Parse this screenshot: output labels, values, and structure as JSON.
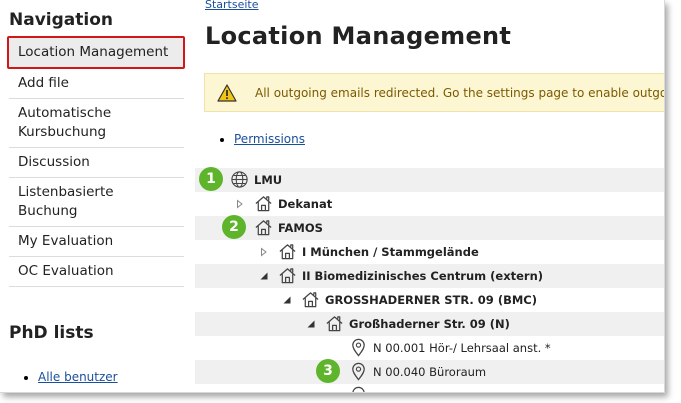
{
  "breadcrumb": "Startseite",
  "sidebar": {
    "heading": "Navigation",
    "items": [
      {
        "label": "Location Management"
      },
      {
        "label": "Add file"
      },
      {
        "label": "Automatische Kursbuchung"
      },
      {
        "label": "Discussion"
      },
      {
        "label": "Listenbasierte Buchung"
      },
      {
        "label": "My Evaluation"
      },
      {
        "label": "OC Evaluation"
      }
    ],
    "phd_heading": "PhD lists",
    "phd_items": [
      {
        "label": "Alle benutzer"
      }
    ]
  },
  "main": {
    "title": "Location Management",
    "alert": "All outgoing emails redirected. Go the settings page to enable outgoing emails.",
    "links": [
      {
        "label": "Permissions"
      }
    ],
    "tree": [
      {
        "label": "LMU",
        "icon": "globe-icon"
      },
      {
        "label": "Dekanat",
        "icon": "house-icon"
      },
      {
        "label": "FAMOS",
        "icon": "house-icon"
      },
      {
        "label": "I München / Stammgelände",
        "icon": "house-icon"
      },
      {
        "label": "II Biomedizinisches Centrum (extern)",
        "icon": "house-icon"
      },
      {
        "label": "GROSSHADERNER STR. 09 (BMC)",
        "icon": "house-icon"
      },
      {
        "label": "Großhaderner Str. 09 (N)",
        "icon": "house-icon"
      },
      {
        "label": "N 00.001 Hör-/ Lehrsaal anst. *",
        "icon": "location-pin-icon"
      },
      {
        "label": "N 00.040 Büroraum",
        "icon": "location-pin-icon"
      }
    ]
  },
  "markers": [
    "1",
    "2",
    "3"
  ],
  "colors": {
    "active_border": "#d0181b",
    "marker": "#5eb52b",
    "link": "#1a4f9c",
    "alert_bg": "#fdf6d3"
  }
}
